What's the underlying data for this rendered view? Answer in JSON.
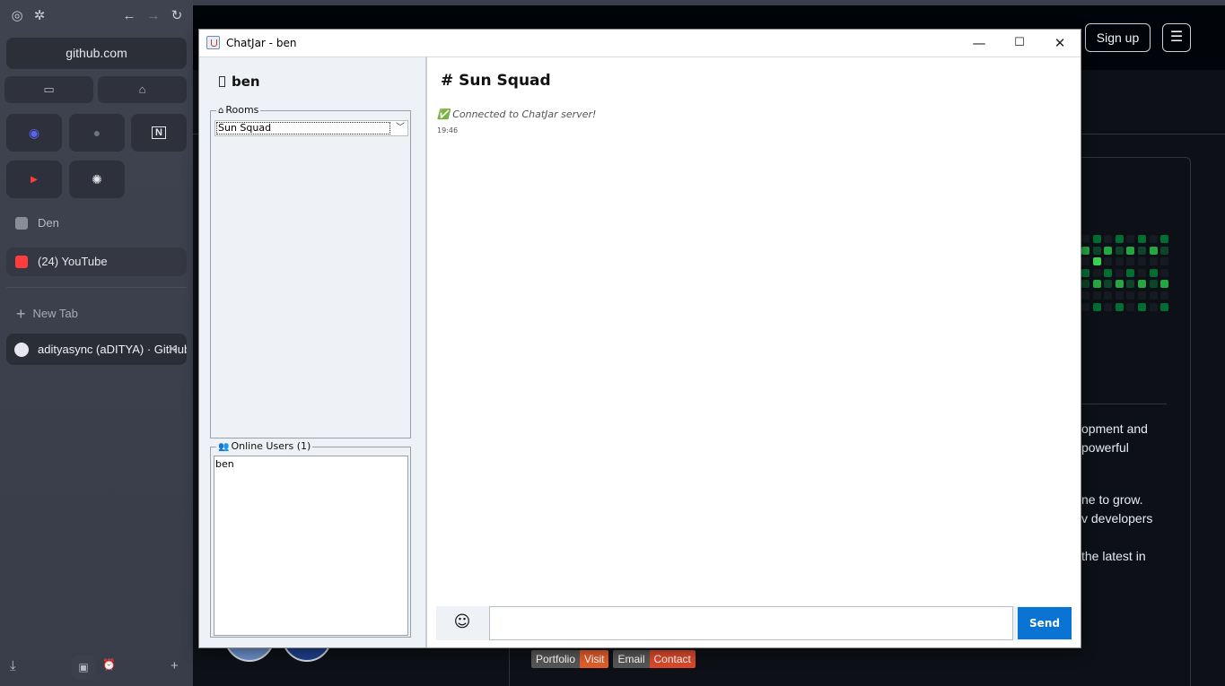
{
  "browser": {
    "url": "github.com",
    "pinned": [
      {
        "name": "discord",
        "glyph": "◉",
        "color": "#5865f2"
      },
      {
        "name": "github",
        "glyph": "●",
        "color": "#6e7380"
      },
      {
        "name": "notion",
        "glyph": "N",
        "color": "#e6e8ee"
      },
      {
        "name": "youtube",
        "glyph": "▶",
        "color": "#ff3d3d"
      },
      {
        "name": "openai",
        "glyph": "✺",
        "color": "#e6e8ee"
      }
    ],
    "tabs": [
      {
        "label": "Den",
        "icon_color": "#8a8d98"
      },
      {
        "label": "(24) YouTube",
        "icon_color": "#ff3d3d"
      }
    ],
    "new_tab_label": "New Tab",
    "active_tab_label": "adityasync (aDITYA) · GitHub"
  },
  "github": {
    "signup_label": "Sign up",
    "text_lines": [
      "opment and",
      "powerful",
      "ne to grow.",
      "v developers",
      "the latest in"
    ],
    "badges": [
      {
        "left": "Portfolio",
        "right": "Visit",
        "right_color": "#e05d2b"
      },
      {
        "left": "Email",
        "right": "Contact",
        "right_color": "#d9482b"
      }
    ],
    "accent_green": "#26a641"
  },
  "chat": {
    "window_title": "ChatJar - ben",
    "username": "ben",
    "rooms_legend": "Rooms",
    "selected_room": "Sun Squad",
    "online_legend": "Online Users (1)",
    "online_users": [
      "ben"
    ],
    "room_title": "# Sun Squad",
    "system_message": "✅ Connected to ChatJar server!",
    "system_time": "19:46",
    "message_input": "",
    "send_label": "Send",
    "emoji_glyph": "☺",
    "accent": "#0a74d4"
  }
}
